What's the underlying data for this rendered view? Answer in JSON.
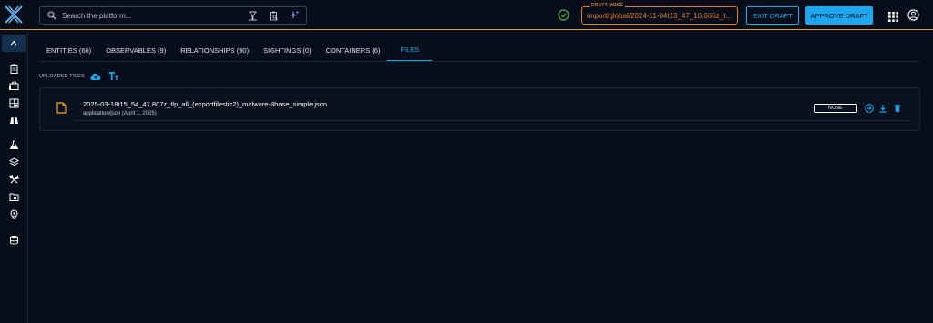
{
  "search": {
    "placeholder": "Search the platform..."
  },
  "draft": {
    "legend": "DRAFT MODE",
    "value": "import/global/2024-11-04t13_47_10.666z_t..."
  },
  "actions": {
    "exit_label": "EXIT DRAFT",
    "approve_label": "APPROVE DRAFT"
  },
  "colors": {
    "accent": "#1ea7ef",
    "draft": "#e07d27",
    "file_icon": "#f5a623",
    "success": "#4caf50",
    "background": "#070d19",
    "border_top": "#d4a246"
  },
  "tabs": [
    {
      "label": "ENTITIES (66)"
    },
    {
      "label": "OBSERVABLES (9)"
    },
    {
      "label": "RELATIONSHIPS (90)"
    },
    {
      "label": "SIGHTINGS (0)"
    },
    {
      "label": "CONTAINERS (6)"
    },
    {
      "label": "FILES",
      "active": true
    }
  ],
  "files_section": {
    "title": "UPLOADED FILES"
  },
  "files": [
    {
      "name": "2025-03-18t15_54_47.807z_tlp_all_(exportfilestix2)_malware-8base_simple.json",
      "meta": "application/json (April 1, 2025)",
      "marking": "NONE"
    }
  ],
  "icons": {
    "logo": "opencti-logo-icon",
    "search": "search-icon",
    "search_actions": [
      "filter-funnel-icon",
      "clipboard-search-icon",
      "ai-sparkles-icon"
    ],
    "status": "check-circle-icon",
    "apps": "apps-grid-icon",
    "user": "user-circle-icon",
    "rail": [
      "collapse-icon",
      "clipboard-icon",
      "briefcase-icon",
      "report-list-icon",
      "binoculars-icon",
      "flask-icon",
      "layers-icon",
      "tools-icon",
      "folder-icon",
      "brain-icon",
      "database-icon"
    ],
    "upload": "cloud-upload-icon",
    "text_import": "text-format-icon",
    "file": "file-icon",
    "file_actions": [
      "arrow-circle-icon",
      "download-icon",
      "delete-icon"
    ]
  }
}
